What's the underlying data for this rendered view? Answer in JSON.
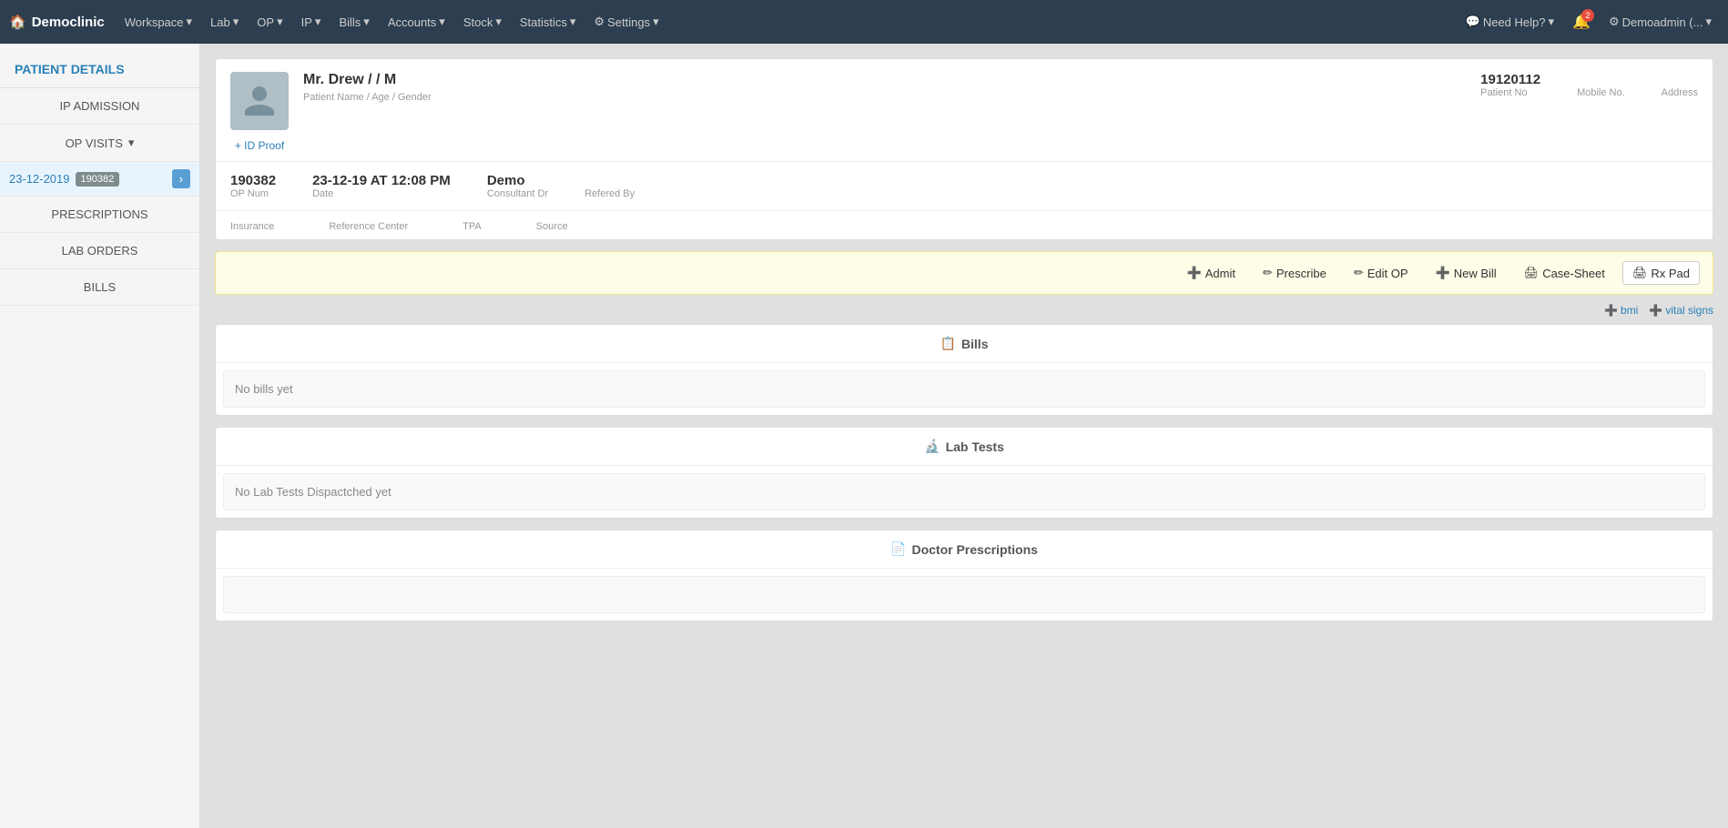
{
  "navbar": {
    "brand": "Democlinic",
    "brand_icon": "🏠",
    "items": [
      {
        "label": "Workspace",
        "has_dropdown": true
      },
      {
        "label": "Lab",
        "has_dropdown": true
      },
      {
        "label": "OP",
        "has_dropdown": true
      },
      {
        "label": "IP",
        "has_dropdown": true
      },
      {
        "label": "Bills",
        "has_dropdown": true
      },
      {
        "label": "Accounts",
        "has_dropdown": true
      },
      {
        "label": "Stock",
        "has_dropdown": true
      },
      {
        "label": "Statistics",
        "has_dropdown": true
      },
      {
        "label": "Settings",
        "has_dropdown": true
      }
    ],
    "help_label": "Need Help?",
    "bell_count": "2",
    "user_label": "Demoadmin (...",
    "gear_icon": "⚙"
  },
  "sidebar": {
    "header": "PATIENT DETAILS",
    "items": [
      {
        "label": "IP ADMISSION",
        "id": "ip-admission"
      },
      {
        "label": "OP VISITS",
        "id": "op-visits",
        "has_dropdown": true
      },
      {
        "label": "PRESCRIPTIONS",
        "id": "prescriptions"
      },
      {
        "label": "LAB ORDERS",
        "id": "lab-orders"
      },
      {
        "label": "BILLS",
        "id": "bills"
      }
    ],
    "active_date": "23-12-2019",
    "active_num": "190382"
  },
  "patient": {
    "name": "Mr. Drew / / M",
    "name_label": "Patient Name / Age / Gender",
    "patient_no": "19120112",
    "patient_no_label": "Patient No",
    "mobile_no_label": "Mobile No.",
    "mobile_no": "",
    "address_label": "Address",
    "address": "",
    "id_proof_label": "+ ID Proof",
    "op_num": "190382",
    "op_num_label": "OP Num",
    "date": "23-12-19 AT 12:08 PM",
    "date_label": "Date",
    "consultant": "Demo",
    "consultant_label": "Consultant Dr",
    "referred_by_label": "Refered By",
    "referred_by": "",
    "insurance_label": "Insurance",
    "insurance": "",
    "reference_center_label": "Reference Center",
    "reference_center": "",
    "tpa_label": "TPA",
    "tpa": "",
    "source_label": "Source",
    "source": ""
  },
  "actions": [
    {
      "label": "Admit",
      "icon": "➕",
      "id": "admit"
    },
    {
      "label": "Prescribe",
      "icon": "✏",
      "id": "prescribe"
    },
    {
      "label": "Edit OP",
      "icon": "✏",
      "id": "edit-op"
    },
    {
      "label": "New Bill",
      "icon": "➕",
      "id": "new-bill"
    },
    {
      "label": "Case-Sheet",
      "icon": "🖨",
      "id": "case-sheet"
    },
    {
      "label": "Rx Pad",
      "icon": "🖨",
      "id": "rx-pad"
    }
  ],
  "vitals": [
    {
      "label": "bmi",
      "icon": "➕"
    },
    {
      "label": "vital signs",
      "icon": "➕"
    }
  ],
  "sections": [
    {
      "id": "bills",
      "icon": "📋",
      "title": "Bills",
      "empty_text": "No bills yet"
    },
    {
      "id": "lab-tests",
      "icon": "🔬",
      "title": "Lab Tests",
      "empty_text": "No Lab Tests Dispactched yet"
    },
    {
      "id": "doctor-prescriptions",
      "icon": "📄",
      "title": "Doctor Prescriptions",
      "empty_text": ""
    }
  ]
}
